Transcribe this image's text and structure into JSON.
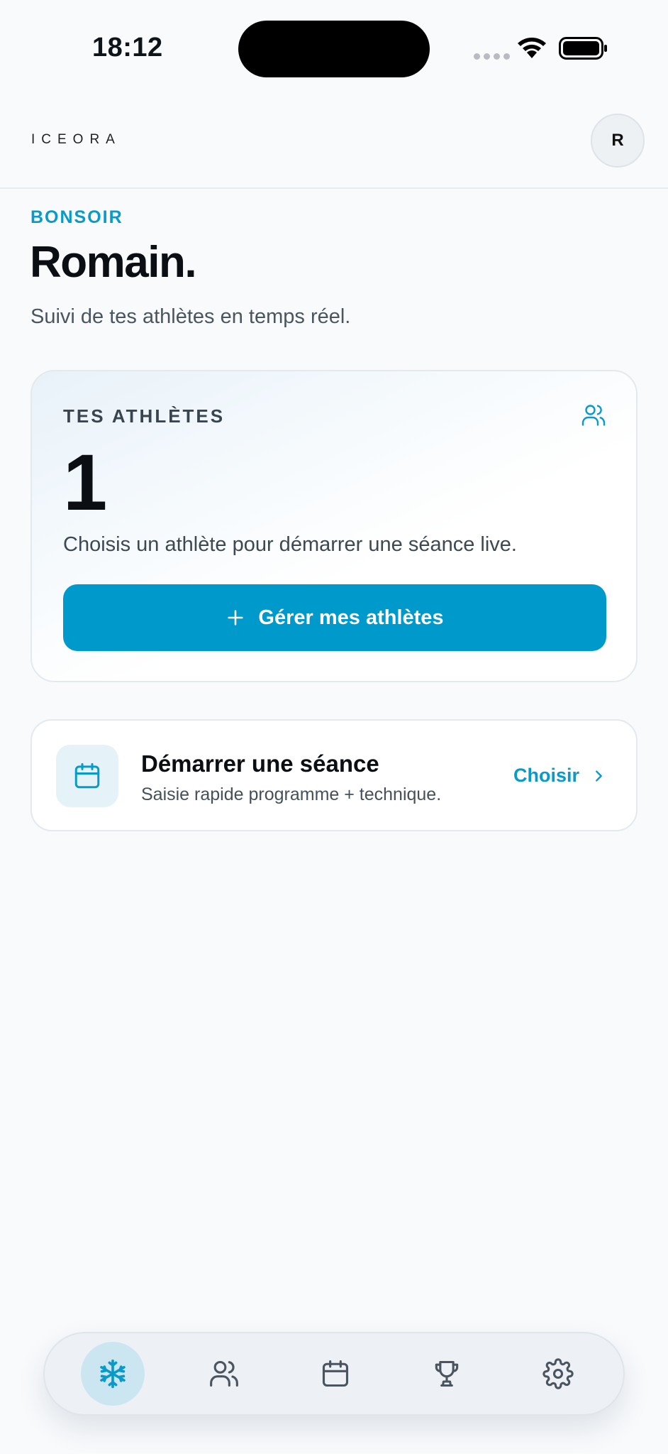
{
  "status_bar": {
    "time": "18:12"
  },
  "header": {
    "brand": "ICEORA",
    "avatar_initial": "R"
  },
  "greeting": {
    "eyebrow": "BONSOIR",
    "name": "Romain.",
    "subtitle": "Suivi de tes athlètes en temps réel."
  },
  "athletes_card": {
    "label": "TES ATHLÈTES",
    "count": "1",
    "description": "Choisis un athlète pour démarrer une séance live.",
    "button_label": "Gérer mes athlètes"
  },
  "session_card": {
    "title": "Démarrer une séance",
    "subtitle": "Saisie rapide programme + technique.",
    "action_label": "Choisir"
  },
  "bottom_nav": {
    "items": [
      {
        "icon": "snowflake-icon",
        "active": true
      },
      {
        "icon": "users-icon",
        "active": false
      },
      {
        "icon": "calendar-icon",
        "active": false
      },
      {
        "icon": "trophy-icon",
        "active": false
      },
      {
        "icon": "gear-icon",
        "active": false
      }
    ]
  },
  "colors": {
    "accent": "#0099cc",
    "accent_text": "#0a9ac9",
    "background": "#f8fafc",
    "nav_active": "#cbe6f1"
  }
}
